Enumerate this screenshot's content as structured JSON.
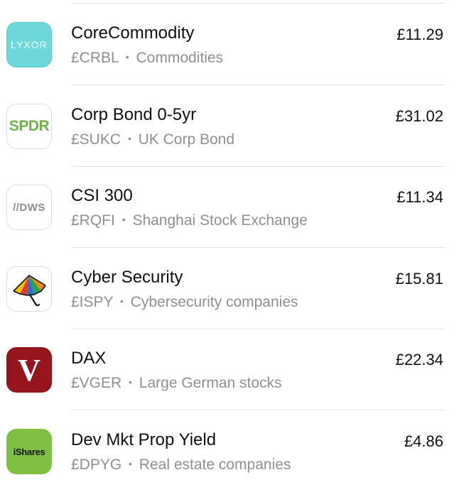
{
  "funds": [
    {
      "logo": "LYXOR",
      "logo_icon": "lyxor-logo-icon",
      "name": "CoreCommodity",
      "ticker": "£CRBL",
      "separator": "•",
      "description": "Commodities",
      "price": "£11.29"
    },
    {
      "logo": "SPDR",
      "logo_icon": "spdr-logo-icon",
      "name": "Corp Bond 0-5yr",
      "ticker": "£SUKC",
      "separator": "•",
      "description": "UK Corp Bond",
      "price": "£31.02"
    },
    {
      "logo": "//DWS",
      "logo_icon": "dws-logo-icon",
      "name": "CSI 300",
      "ticker": "£RQFI",
      "separator": "•",
      "description": "Shanghai Stock Exchange",
      "price": "£11.34"
    },
    {
      "logo": "",
      "logo_icon": "umbrella-logo-icon",
      "name": "Cyber Security",
      "ticker": "£ISPY",
      "separator": "•",
      "description": "Cybersecurity companies",
      "price": "£15.81"
    },
    {
      "logo": "V",
      "logo_icon": "vanguard-logo-icon",
      "name": "DAX",
      "ticker": "£VGER",
      "separator": "•",
      "description": "Large German stocks",
      "price": "£22.34"
    },
    {
      "logo": "iShares",
      "logo_icon": "ishares-logo-icon",
      "name": "Dev Mkt Prop Yield",
      "ticker": "£DPYG",
      "separator": "•",
      "description": "Real estate companies",
      "price": "£4.86"
    }
  ],
  "colors": {
    "lyxor": "#6dd8dc",
    "spdr_text": "#6fb24a",
    "vanguard": "#96151d",
    "ishares": "#7ec142",
    "subtitle": "#8e8e93"
  }
}
